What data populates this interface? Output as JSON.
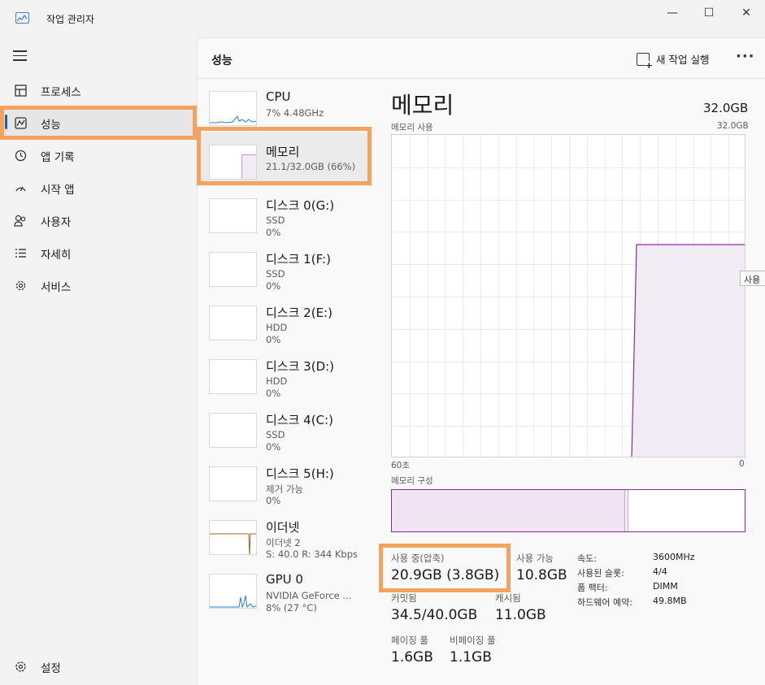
{
  "window": {
    "title": "작업 관리자",
    "minimize": "—",
    "maximize": "☐",
    "close": "✕"
  },
  "sidebar": {
    "items": [
      {
        "label": "프로세스",
        "icon": "processes-icon"
      },
      {
        "label": "성능",
        "icon": "performance-icon"
      },
      {
        "label": "앱 기록",
        "icon": "app-history-icon"
      },
      {
        "label": "시작 앱",
        "icon": "startup-apps-icon"
      },
      {
        "label": "사용자",
        "icon": "users-icon"
      },
      {
        "label": "자세히",
        "icon": "details-icon"
      },
      {
        "label": "서비스",
        "icon": "services-icon"
      }
    ],
    "settings": {
      "label": "설정",
      "icon": "settings-icon"
    }
  },
  "header": {
    "title": "성능",
    "run_task": "새 작업 실행",
    "more": "···"
  },
  "devices": [
    {
      "name": "CPU",
      "sub1": "7% 4.48GHz",
      "sub2": ""
    },
    {
      "name": "메모리",
      "sub1": "21.1/32.0GB (66%)",
      "sub2": ""
    },
    {
      "name": "디스크 0(G:)",
      "sub1": "SSD",
      "sub2": "0%"
    },
    {
      "name": "디스크 1(F:)",
      "sub1": "SSD",
      "sub2": "0%"
    },
    {
      "name": "디스크 2(E:)",
      "sub1": "HDD",
      "sub2": "0%"
    },
    {
      "name": "디스크 3(D:)",
      "sub1": "HDD",
      "sub2": "0%"
    },
    {
      "name": "디스크 4(C:)",
      "sub1": "SSD",
      "sub2": "0%"
    },
    {
      "name": "디스크 5(H:)",
      "sub1": "제거 가능",
      "sub2": "0%"
    },
    {
      "name": "이더넷",
      "sub1": "이더넷 2",
      "sub2": "S: 40.0 R: 344 Kbps"
    },
    {
      "name": "GPU 0",
      "sub1": "NVIDIA GeForce ...",
      "sub2": "8% (27 °C)"
    }
  ],
  "detail": {
    "title": "메모리",
    "total": "32.0GB",
    "usage_label": "메모리 사용",
    "usage_max": "32.0GB",
    "x_left": "60초",
    "x_right": "0",
    "tooltip": "사용",
    "composition_label": "메모리 구성",
    "usage_percent": 66,
    "in_use_label": "사용 중(압축)",
    "in_use_value": "20.9GB (3.8GB)",
    "available_label": "사용 가능",
    "available_value": "10.8GB",
    "committed_label": "커밋됨",
    "committed_value": "34.5/40.0GB",
    "cached_label": "캐시됨",
    "cached_value": "11.0GB",
    "paged_label": "페이징 풀",
    "paged_value": "1.6GB",
    "nonpaged_label": "비페이징 풀",
    "nonpaged_value": "1.1GB",
    "specs": [
      {
        "k": "속도:",
        "v": "3600MHz"
      },
      {
        "k": "사용된 슬롯:",
        "v": "4/4"
      },
      {
        "k": "폼 팩터:",
        "v": "DIMM"
      },
      {
        "k": "하드웨어 예약:",
        "v": "49.8MB"
      }
    ]
  },
  "colors": {
    "memory_line": "#8a2aa6",
    "memory_fill": "#f1ecf3",
    "cpu_line": "#2b7cd3",
    "ethernet_line": "#a2641f",
    "highlight": "#f4a35f"
  }
}
